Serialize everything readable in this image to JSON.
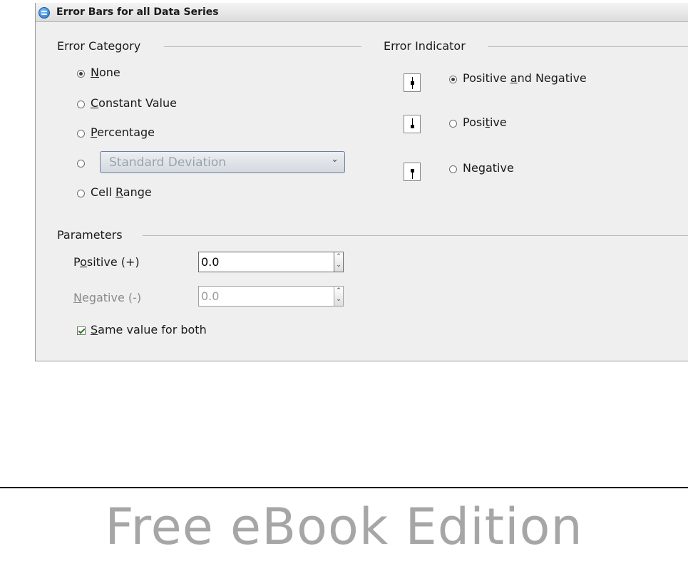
{
  "dialog": {
    "title": "Error Bars for all Data Series",
    "error_category": {
      "heading": "Error Category",
      "options": [
        {
          "pre": "",
          "u": "N",
          "post": "one",
          "checked": true
        },
        {
          "pre": "",
          "u": "C",
          "post": "onstant Value",
          "checked": false
        },
        {
          "pre": "",
          "u": "P",
          "post": "ercentage",
          "checked": false
        },
        {
          "pre": "Cell ",
          "u": "R",
          "post": "ange",
          "checked": false
        }
      ],
      "function_select_value": "Standard Deviation"
    },
    "error_indicator": {
      "heading": "Error Indicator",
      "options": [
        {
          "pre": "Positive ",
          "u": "a",
          "post": "nd Negative",
          "checked": true
        },
        {
          "pre": "Posi",
          "u": "t",
          "post": "ive",
          "checked": false
        },
        {
          "pre": "Ne",
          "u": "g",
          "post": "ative",
          "checked": false
        }
      ]
    },
    "parameters": {
      "heading": "Parameters",
      "positive": {
        "pre": "P",
        "u": "o",
        "post": "sitive (+)",
        "value": "0.0"
      },
      "negative": {
        "pre": "",
        "u": "N",
        "post": "egative (-)",
        "value": "0.0"
      },
      "same_value": {
        "pre": "",
        "u": "S",
        "post": "ame value for both",
        "checked": true
      }
    }
  },
  "watermark": "Free eBook Edition"
}
